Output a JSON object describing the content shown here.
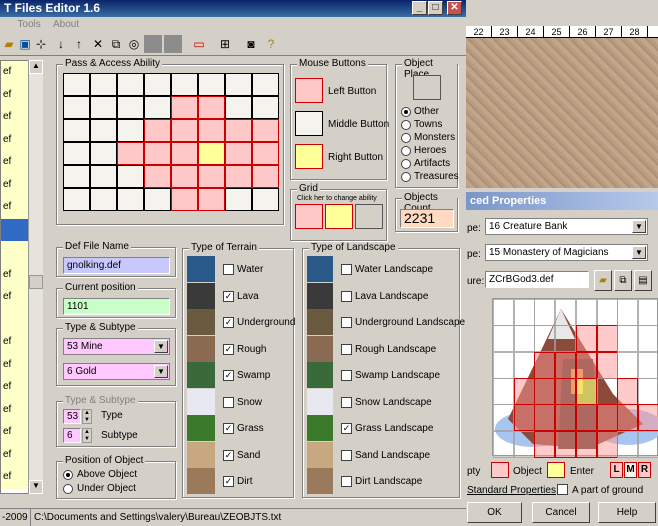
{
  "window": {
    "title": "T Files Editor 1.6"
  },
  "menu": {
    "tools": "Tools",
    "about": "About"
  },
  "left_list": {
    "items": [
      "ef",
      "ef",
      "ef",
      "ef",
      "ef",
      "ef",
      "ef",
      "",
      "",
      "ef",
      "ef",
      "",
      "ef",
      "ef",
      "ef",
      "ef",
      "ef",
      "ef",
      "ef"
    ],
    "selected_index": 7
  },
  "pass_access": {
    "title": "Pass & Access Ability"
  },
  "mouse_buttons": {
    "title": "Mouse Buttons",
    "left": "Left Button",
    "middle": "Middle Button",
    "right": "Right Button"
  },
  "object_place": {
    "title": "Object Place",
    "options": [
      "Other",
      "Towns",
      "Monsters",
      "Heroes",
      "Artifacts",
      "Treasures"
    ],
    "selected": "Other"
  },
  "grid": {
    "title": "Grid",
    "hint": "Click her to change ability"
  },
  "objects_count": {
    "title": "Objects Count",
    "value": "2231"
  },
  "def_file": {
    "title": "Def File Name",
    "value": "gnolking.def"
  },
  "current_position": {
    "title": "Current position",
    "value": "1101"
  },
  "type_subtype": {
    "title": "Type & Subtype",
    "type_value": "53  Mine",
    "subtype_value": "6  Gold"
  },
  "type_subtype2": {
    "title": "Type & Subtype",
    "type_num": "53",
    "type_label": "Type",
    "subtype_num": "6",
    "subtype_label": "Subtype"
  },
  "position_obj": {
    "title": "Position of Object",
    "above": "Above Object",
    "under": "Under Object"
  },
  "terrain": {
    "title": "Type of Terrain",
    "items": [
      {
        "label": "Water",
        "checked": false
      },
      {
        "label": "Lava",
        "checked": true
      },
      {
        "label": "Underground",
        "checked": true
      },
      {
        "label": "Rough",
        "checked": true
      },
      {
        "label": "Swamp",
        "checked": true
      },
      {
        "label": "Snow",
        "checked": false
      },
      {
        "label": "Grass",
        "checked": true
      },
      {
        "label": "Sand",
        "checked": true
      },
      {
        "label": "Dirt",
        "checked": true
      }
    ]
  },
  "landscape": {
    "title": "Type of Landscape",
    "items": [
      {
        "label": "Water Landscape",
        "checked": false
      },
      {
        "label": "Lava Landscape",
        "checked": false
      },
      {
        "label": "Underground Landscape",
        "checked": false
      },
      {
        "label": "Rough Landscape",
        "checked": false
      },
      {
        "label": "Swamp Landscape",
        "checked": false
      },
      {
        "label": "Snow Landscape",
        "checked": false
      },
      {
        "label": "Grass Landscape",
        "checked": true
      },
      {
        "label": "Sand Landscape",
        "checked": false
      },
      {
        "label": "Dirt Landscape",
        "checked": false
      }
    ]
  },
  "status": {
    "year": "-2009",
    "path": "C:\\Documents and Settings\\valery\\Bureau\\ZEOBJTS.txt"
  },
  "ruler": [
    "22",
    "23",
    "24",
    "25",
    "26",
    "27",
    "28"
  ],
  "adv": {
    "title": "ced Properties",
    "type_label": "pe:",
    "type_value": "16  Creature Bank",
    "subtype_label": "pe:",
    "subtype_value": "15  Monastery of Magicians",
    "pic_label": "ure:",
    "pic_value": "ZCrBGod3.def",
    "legend_empty": "pty",
    "legend_object": "Object",
    "legend_enter": "Enter",
    "lmr": [
      "L",
      "M",
      "R"
    ],
    "standard": "Standard Properties",
    "ground": "A part of ground",
    "ok": "OK",
    "cancel": "Cancel",
    "help": "Help"
  }
}
